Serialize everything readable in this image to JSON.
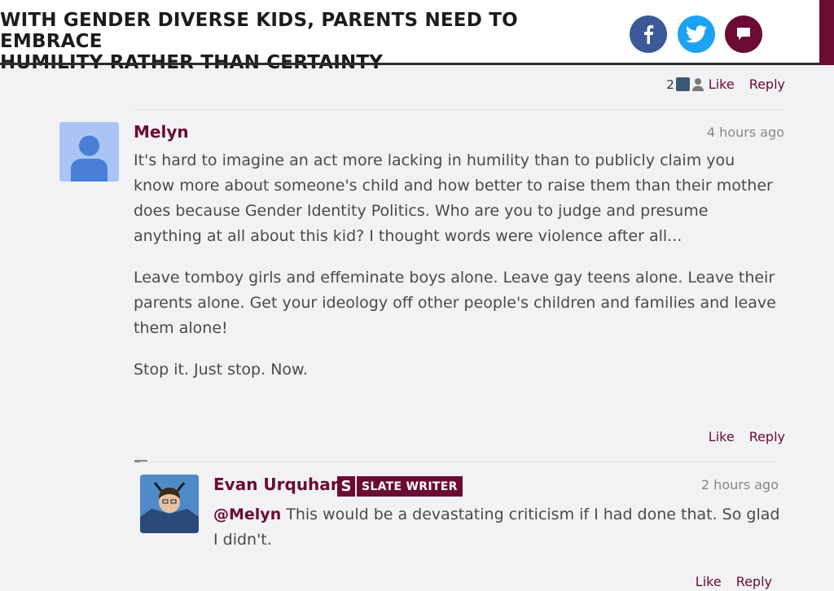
{
  "header": {
    "title_line1": "WITH GENDER DIVERSE KIDS, PARENTS NEED TO EMBRACE",
    "title_line2": "HUMILITY RATHER THAN CERTAINTY",
    "share": [
      {
        "icon": "facebook-icon",
        "color": "#3b5998"
      },
      {
        "icon": "twitter-icon",
        "color": "#1da1f2"
      },
      {
        "icon": "comment-icon",
        "color": "#6b0b33"
      }
    ]
  },
  "top_actions": {
    "like_count": "2",
    "like_label": "Like",
    "reply_label": "Reply"
  },
  "comment": {
    "author": "Melyn",
    "time": "4 hours ago",
    "paragraphs": [
      "It's hard to imagine an act more lacking in humility than to publicly claim you know more about someone's child and how better to raise them than their mother does because Gender Identity Politics. Who are you to judge and presume anything at all about this kid? I thought words were violence after all...",
      "Leave tomboy girls and effeminate boys alone. Leave gay teens alone. Leave their parents alone. Get your ideology off other people's children and families and leave them alone!",
      "Stop it. Just stop. Now."
    ],
    "like_label": "Like",
    "reply_label": "Reply"
  },
  "reply": {
    "author": "Evan Urquhart",
    "badge_letter": "S",
    "badge_text": "SLATE WRITER",
    "time": "2 hours ago",
    "mention": "@Melyn",
    "text": " This would be a devastating criticism if I had done that. So glad I didn't.",
    "like_label": "Like",
    "reply_label": "Reply"
  },
  "colors": {
    "accent": "#6b0b33",
    "background": "#f2f2f4"
  }
}
